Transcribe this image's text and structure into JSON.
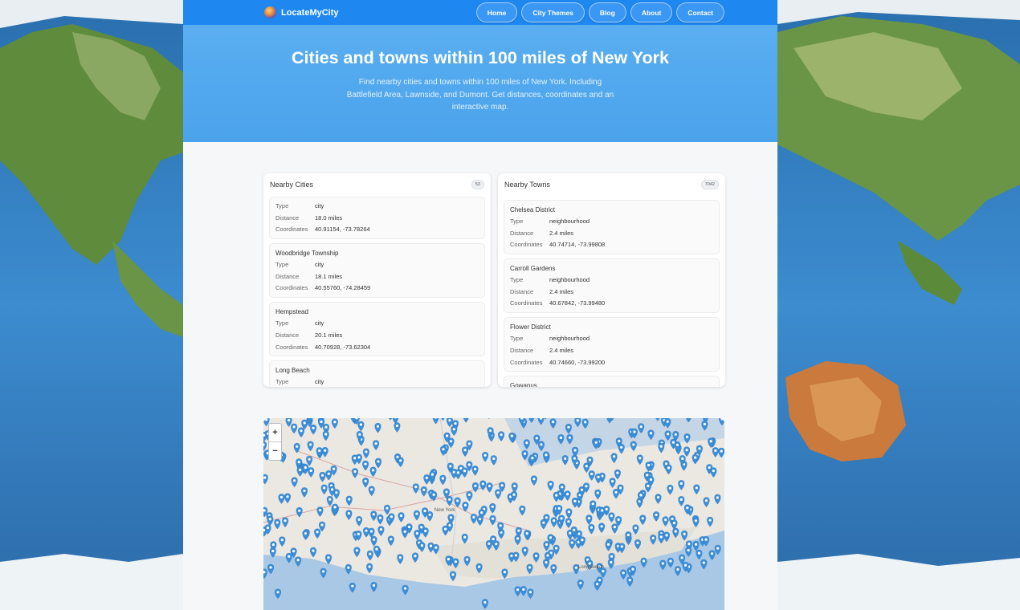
{
  "nav": {
    "brand": "LocateMyCity",
    "links": [
      "Home",
      "City Themes",
      "Blog",
      "About",
      "Contact"
    ]
  },
  "hero": {
    "title": "Cities and towns within 100 miles of New York",
    "description": "Find nearby cities and towns within 100 miles of New York. Including Battlefield Area, Lawnside, and Dumont. Get distances, coordinates and an interactive map."
  },
  "labels": {
    "type": "Type",
    "distance": "Distance",
    "coordinates": "Coordinates"
  },
  "cities": {
    "title": "Nearby Cities",
    "count": "53",
    "items": [
      {
        "name": "",
        "type": "city",
        "distance": "18.0 miles",
        "coordinates": "40.91154, -73.78264"
      },
      {
        "name": "Woodbridge Township",
        "type": "city",
        "distance": "18.1 miles",
        "coordinates": "40.55760, -74.28459"
      },
      {
        "name": "Hempstead",
        "type": "city",
        "distance": "20.1 miles",
        "coordinates": "40.70928, -73.62304"
      },
      {
        "name": "Long Beach",
        "type": "city",
        "distance": "",
        "coordinates": ""
      }
    ]
  },
  "towns": {
    "title": "Nearby Towns",
    "count": "7042",
    "items": [
      {
        "name": "Chelsea District",
        "type": "neighbourhood",
        "distance": "2.4 miles",
        "coordinates": "40.74714, -73.99808"
      },
      {
        "name": "Carroll Gardens",
        "type": "neighbourhood",
        "distance": "2.4 miles",
        "coordinates": "40.67842, -73.99480"
      },
      {
        "name": "Flower District",
        "type": "neighbourhood",
        "distance": "2.4 miles",
        "coordinates": "40.74660, -73.99200"
      },
      {
        "name": "Gowanus",
        "type": "",
        "distance": "",
        "coordinates": ""
      }
    ]
  },
  "map": {
    "zoom_in": "+",
    "zoom_out": "−",
    "place_labels": [
      "New York",
      "Long Beach"
    ],
    "marker_color": "#3b8fd9"
  },
  "colors": {
    "nav": "#1e87f0",
    "hero": "#4ba3ec",
    "marker": "#3b8fd9"
  }
}
